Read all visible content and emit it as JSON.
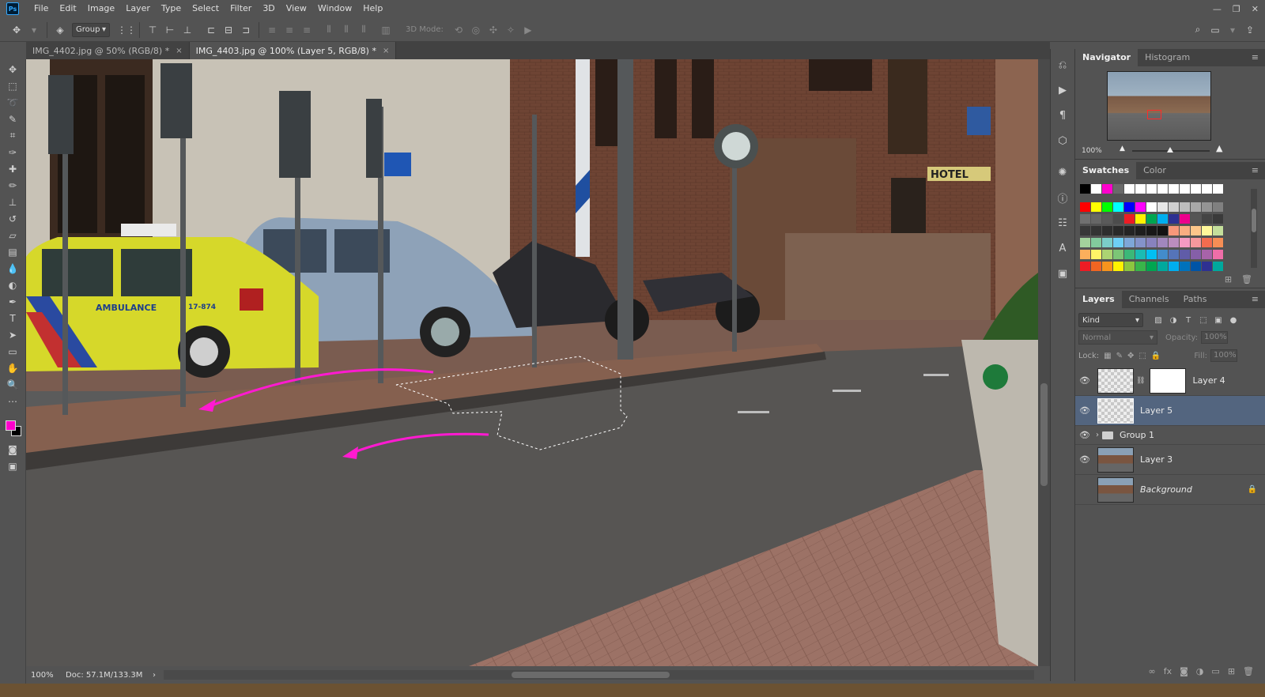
{
  "app": {
    "logo": "Ps"
  },
  "menu": [
    "File",
    "Edit",
    "Image",
    "Layer",
    "Type",
    "Select",
    "Filter",
    "3D",
    "View",
    "Window",
    "Help"
  ],
  "window_controls": {
    "minimize": "—",
    "restore": "❐",
    "close": "✕"
  },
  "options_bar": {
    "auto_select": "Group",
    "mode_3d": "3D Mode:"
  },
  "tabs": [
    {
      "label": "IMG_4402.jpg @ 50% (RGB/8) *",
      "active": false
    },
    {
      "label": "IMG_4403.jpg @ 100% (Layer 5, RGB/8) *",
      "active": true
    }
  ],
  "tab_close": "×",
  "status": {
    "zoom": "100%",
    "doc": "Doc: 57.1M/133.3M",
    "arrow": "›"
  },
  "colors": {
    "foreground": "#ff00cc",
    "background": "#000000",
    "selected_layer": "#53657f",
    "annotation_arrow": "#ff1ad1"
  },
  "navigator": {
    "tabs": [
      "Navigator",
      "Histogram"
    ],
    "zoom": "100%"
  },
  "swatches": {
    "tabs": [
      "Swatches",
      "Color"
    ]
  },
  "layers": {
    "tabs": [
      "Layers",
      "Channels",
      "Paths"
    ],
    "filter_kind": "Kind",
    "blend_mode": "Normal",
    "opacity_label": "Opacity:",
    "opacity": "100%",
    "lock_label": "Lock:",
    "fill_label": "Fill:",
    "fill": "100%",
    "items": [
      {
        "name": "Layer 4",
        "visible": true,
        "selected": false,
        "has_mask": true
      },
      {
        "name": "Layer 5",
        "visible": true,
        "selected": true
      },
      {
        "name": "Group 1",
        "visible": true,
        "group": true
      },
      {
        "name": "Layer 3",
        "visible": true,
        "photo": true
      },
      {
        "name": "Background",
        "visible": false,
        "photo": true,
        "locked": true
      }
    ]
  },
  "scene": {
    "hotel_sign": "HOTEL",
    "ambulance_label": "AMBULANCE",
    "ambulance_number": "17-874"
  }
}
